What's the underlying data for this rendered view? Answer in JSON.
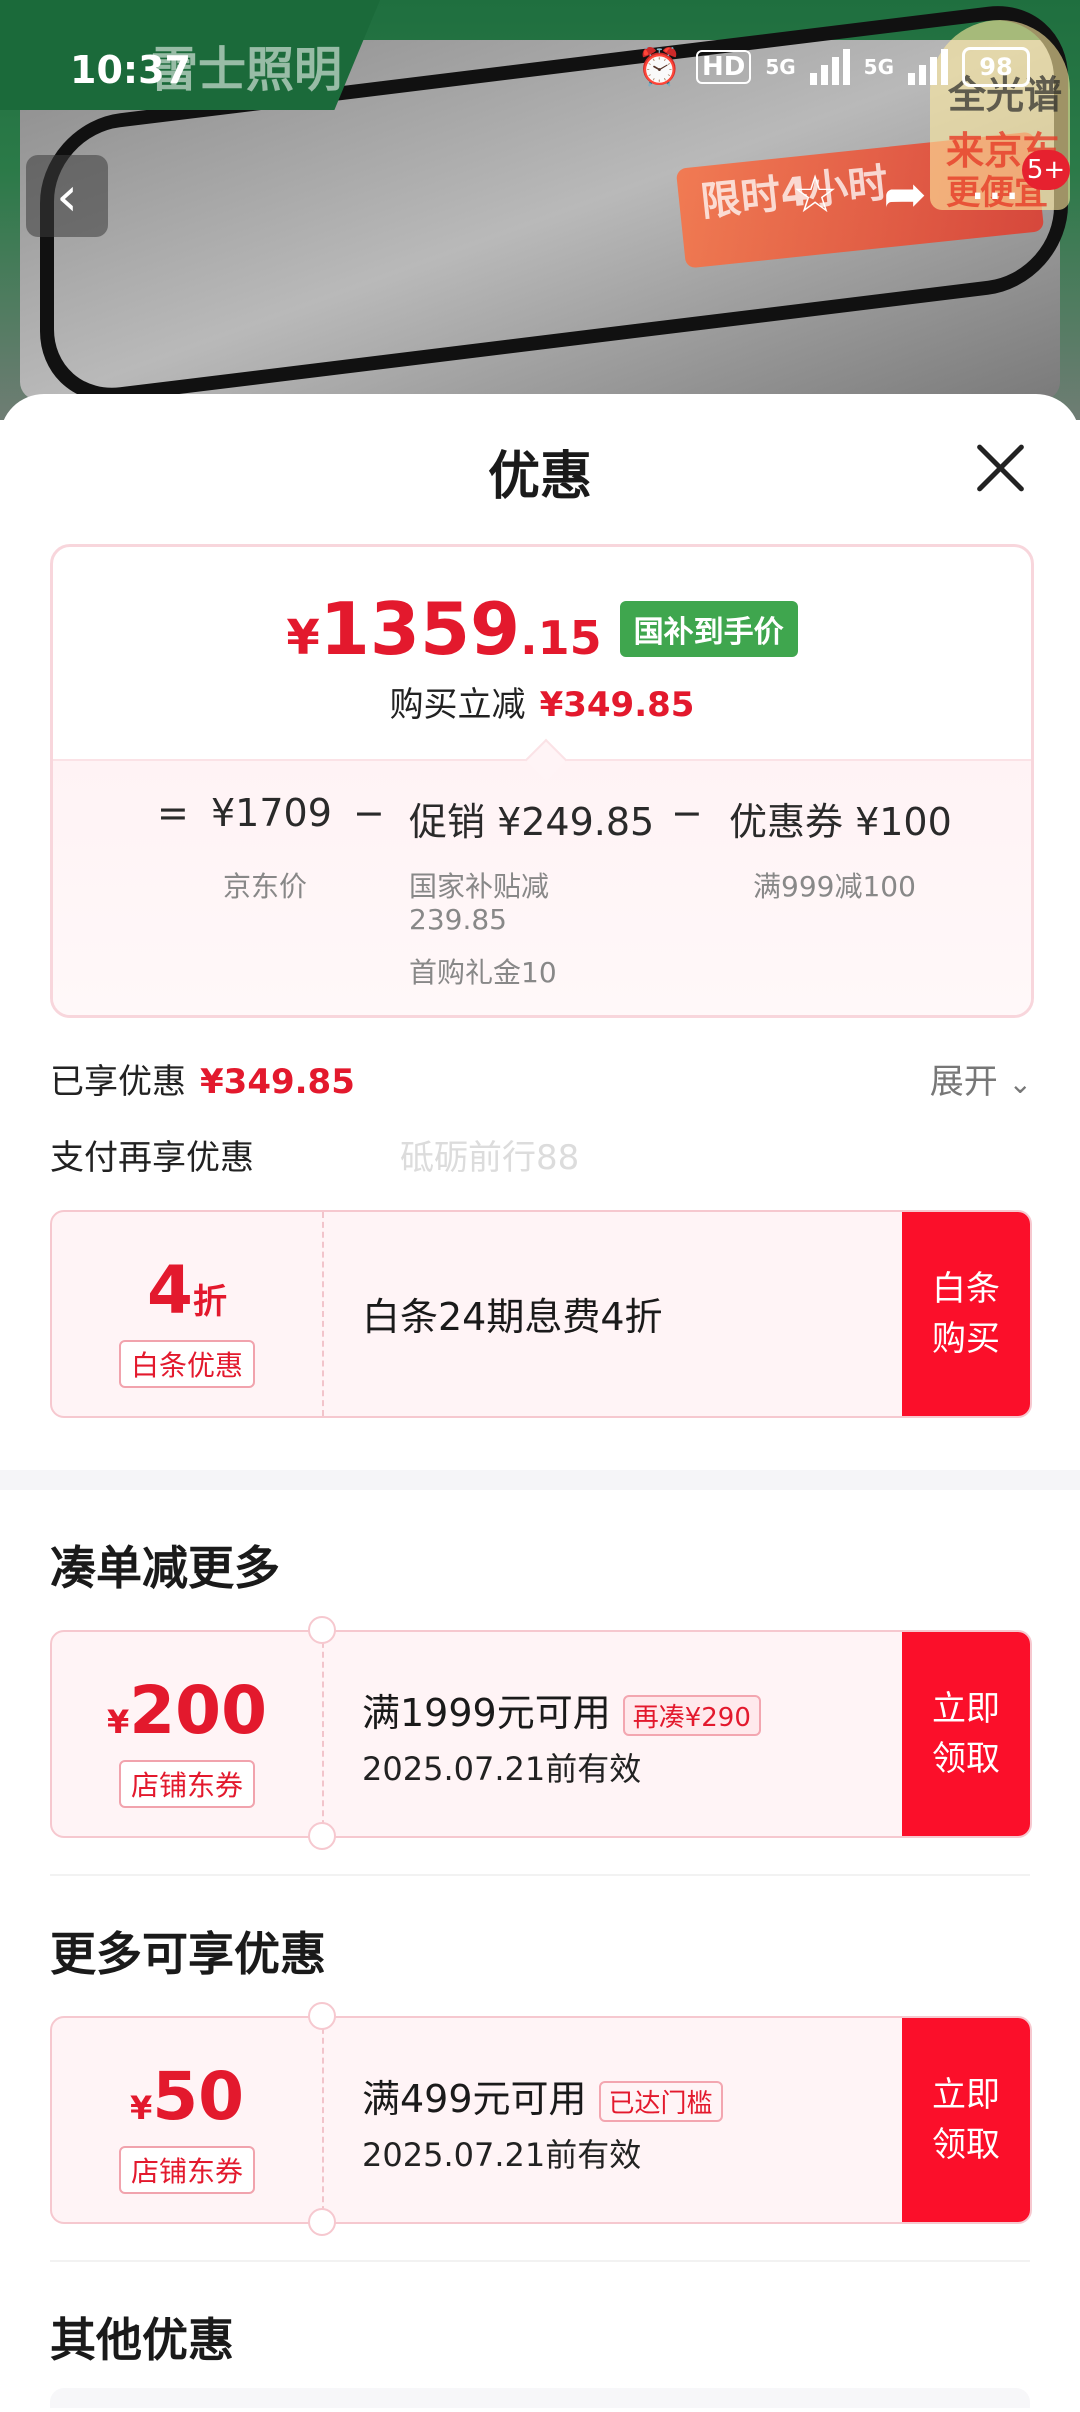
{
  "status_bar": {
    "time": "10:37",
    "hd_label": "HD",
    "network_1": "5G",
    "network_2": "5G",
    "battery": "98"
  },
  "background": {
    "brand_text": "雷士照明",
    "promo_text": "限时4小时",
    "corner_logo_line1": "全光谱",
    "corner_logo_line2": "来京东",
    "corner_logo_line3": "更便宜",
    "cart_count": "5+"
  },
  "sheet": {
    "title": "优惠",
    "price": {
      "symbol": "¥",
      "integer": "1359",
      "decimal": ".15",
      "tag": "国补到手价",
      "saving_label": "购买立减",
      "saving_value": "¥349.85"
    },
    "breakdown": {
      "equals": "=",
      "jd_price": "¥1709",
      "jd_price_label": "京东价",
      "minus_1": "−",
      "promo": "促销 ¥249.85",
      "promo_sub1": "国家补贴减",
      "promo_sub2": "239.85",
      "promo_sub3": "首购礼金10",
      "minus_2": "−",
      "coupon": "优惠券 ¥100",
      "coupon_sub": "满999减100"
    },
    "enjoyed_label": "已享优惠",
    "enjoyed_value": "¥349.85",
    "expand_label": "展开",
    "pay_more_label": "支付再享优惠",
    "watermark": "砥砺前行88",
    "baitiao": {
      "num": "4",
      "unit": "折",
      "type": "白条优惠",
      "desc": "白条24期息费4折",
      "action": "白条购买"
    },
    "section_more": "凑单减更多",
    "coupon_200": {
      "currency": "¥",
      "num": "200",
      "type": "店铺东券",
      "desc": "满1999元可用",
      "badge": "再凑¥290",
      "valid": "2025.07.21前有效",
      "action": "立即领取"
    },
    "section_enjoy": "更多可享优惠",
    "coupon_50": {
      "currency": "¥",
      "num": "50",
      "type": "店铺东券",
      "desc": "满499元可用",
      "badge": "已达门槛",
      "valid": "2025.07.21前有效",
      "action": "立即领取"
    },
    "section_other": "其他优惠"
  },
  "colors": {
    "accent_red": "#e3192d",
    "button_red": "#fb0f2a",
    "tag_green": "#3fa64e"
  },
  "icons": [
    "alarm-icon",
    "back-arrow-icon",
    "star-icon",
    "share-icon",
    "more-icon",
    "close-icon",
    "chevron-down-icon"
  ]
}
